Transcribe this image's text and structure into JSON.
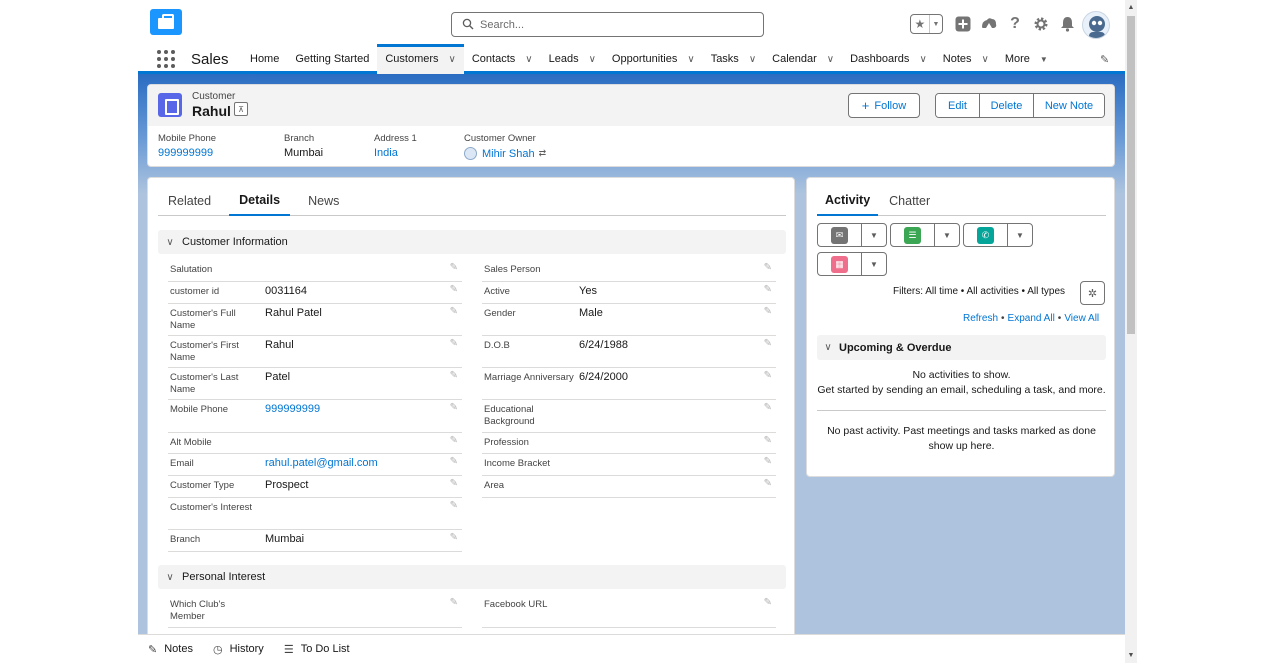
{
  "header": {
    "search_placeholder": "Search..."
  },
  "nav": {
    "app_name": "Sales",
    "items": [
      {
        "label": "Home"
      },
      {
        "label": "Getting Started"
      },
      {
        "label": "Customers"
      },
      {
        "label": "Contacts"
      },
      {
        "label": "Leads"
      },
      {
        "label": "Opportunities"
      },
      {
        "label": "Tasks"
      },
      {
        "label": "Calendar"
      },
      {
        "label": "Dashboards"
      },
      {
        "label": "Notes"
      },
      {
        "label": "More"
      }
    ]
  },
  "record": {
    "object_label": "Customer",
    "name": "Rahul",
    "follow_label": "Follow",
    "edit_label": "Edit",
    "delete_label": "Delete",
    "new_note_label": "New Note",
    "highlights": [
      {
        "label": "Mobile Phone",
        "value": "999999999"
      },
      {
        "label": "Branch",
        "value": "Mumbai"
      },
      {
        "label": "Address 1",
        "value": "India"
      },
      {
        "label": "Customer Owner",
        "value": "Mihir Shah"
      }
    ]
  },
  "details": {
    "tabs": [
      "Related",
      "Details",
      "News"
    ],
    "section1": "Customer Information",
    "section2": "Personal Interest",
    "left_fields": [
      {
        "label": "Salutation",
        "value": ""
      },
      {
        "label": "customer id",
        "value": "0031164"
      },
      {
        "label": "Customer's Full Name",
        "value": "Rahul Patel"
      },
      {
        "label": "Customer's First Name",
        "value": "Rahul"
      },
      {
        "label": "Customer's Last Name",
        "value": "Patel"
      },
      {
        "label": "Mobile Phone",
        "value": "999999999"
      },
      {
        "label": "Alt Mobile",
        "value": ""
      },
      {
        "label": "Email",
        "value": "rahul.patel@gmail.com"
      },
      {
        "label": "Customer Type",
        "value": "Prospect"
      },
      {
        "label": "Customer's Interest",
        "value": ""
      },
      {
        "label": "Branch",
        "value": "Mumbai"
      }
    ],
    "right_fields": [
      {
        "label": "Sales Person",
        "value": ""
      },
      {
        "label": "Active",
        "value": "Yes"
      },
      {
        "label": "Gender",
        "value": "Male"
      },
      {
        "label": "D.O.B",
        "value": "6/24/1988"
      },
      {
        "label": "Marriage Anniversary",
        "value": "6/24/2000"
      },
      {
        "label": "Educational Background",
        "value": ""
      },
      {
        "label": "Profession",
        "value": ""
      },
      {
        "label": "Income Bracket",
        "value": ""
      },
      {
        "label": "Area",
        "value": ""
      }
    ],
    "interest_left": {
      "label": "Which Club's Member",
      "value": ""
    },
    "interest_right": {
      "label": "Facebook URL",
      "value": ""
    }
  },
  "activity": {
    "tabs": [
      "Activity",
      "Chatter"
    ],
    "filters": "Filters: All time • All activities • All types",
    "refresh": "Refresh",
    "expand_all": "Expand All",
    "view_all": "View All",
    "upcoming_title": "Upcoming & Overdue",
    "no_activities": "No activities to show.",
    "get_started": "Get started by sending an email, scheduling a task, and more.",
    "no_past": "No past activity. Past meetings and tasks marked as done show up here."
  },
  "utility": {
    "notes": "Notes",
    "history": "History",
    "todo": "To Do List"
  },
  "colors": {
    "brand": "#0176d3",
    "customer_icon": "#5867e8",
    "email_icon": "#747474",
    "task_icon": "#3ba755",
    "call_icon": "#06a59a",
    "event_icon": "#ef6e8c"
  }
}
